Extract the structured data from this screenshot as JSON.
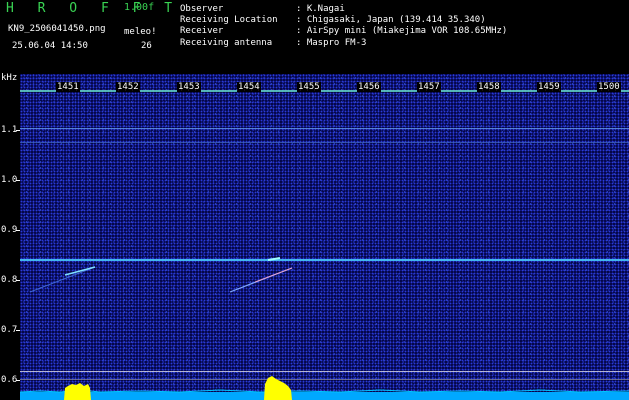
{
  "header": {
    "title": "H R O F F T",
    "version": "1.00f",
    "filename": "KN9_2506041450.png",
    "meleo_label": "meleo!",
    "timestamp": "25.06.04 14:50",
    "count": "26"
  },
  "info": [
    {
      "key": "Observer",
      "value": ": K.Nagai"
    },
    {
      "key": "Receiving Location",
      "value": ": Chigasaki, Japan (139.414 35.340)"
    },
    {
      "key": "Receiver",
      "value": ": AirSpy mini (Miakejima VOR 108.65MHz)"
    },
    {
      "key": "Receiving antenna",
      "value": ": Maspro FM-3"
    }
  ],
  "spectrogram": {
    "unit": "kHz",
    "frequency_labels": [
      "1.1",
      "1.0",
      "0.9",
      "0.8",
      "0.7",
      "0.6"
    ],
    "time_labels": [
      "1451",
      "1452",
      "1453",
      "1454",
      "1455",
      "1456",
      "1457",
      "1458",
      "1459",
      "1500"
    ],
    "colors": {
      "background": "#05074a",
      "noise": "#2a3ad8",
      "carrier": "#49c9ff",
      "level_fill": "#00a8ff",
      "detection": "#ffff00"
    }
  }
}
